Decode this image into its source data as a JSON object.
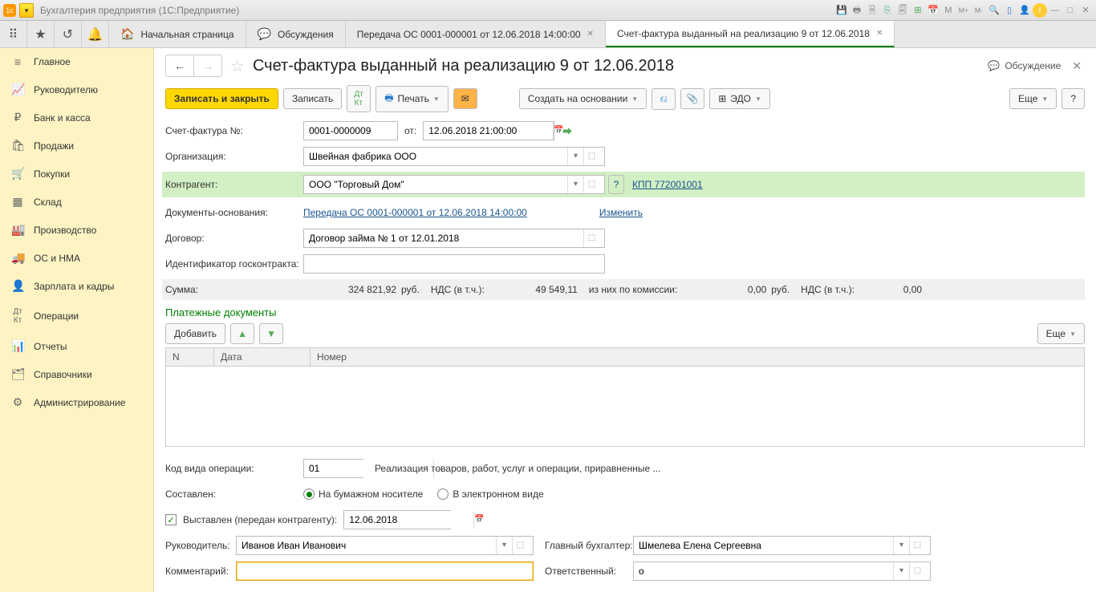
{
  "title_bar": {
    "app_title": "Бухгалтерия предприятия  (1С:Предприятие)"
  },
  "tabs": {
    "home": "Начальная страница",
    "discuss": "Обсуждения",
    "t1": "Передача ОС 0001-000001 от 12.06.2018 14:00:00",
    "t2": "Счет-фактура выданный на реализацию 9 от 12.06.2018"
  },
  "sidebar": {
    "items": [
      {
        "label": "Главное"
      },
      {
        "label": "Руководителю"
      },
      {
        "label": "Банк и касса"
      },
      {
        "label": "Продажи"
      },
      {
        "label": "Покупки"
      },
      {
        "label": "Склад"
      },
      {
        "label": "Производство"
      },
      {
        "label": "ОС и НМА"
      },
      {
        "label": "Зарплата и кадры"
      },
      {
        "label": "Операции"
      },
      {
        "label": "Отчеты"
      },
      {
        "label": "Справочники"
      },
      {
        "label": "Администрирование"
      }
    ]
  },
  "page": {
    "title": "Счет-фактура выданный на реализацию 9 от 12.06.2018",
    "discuss_label": "Обсуждение"
  },
  "toolbar": {
    "save_close": "Записать и закрыть",
    "save": "Записать",
    "print": "Печать",
    "create_based": "Создать на основании",
    "edo": "ЭДО",
    "more": "Еще",
    "help": "?"
  },
  "form": {
    "invoice_no_label": "Счет-фактура №:",
    "invoice_no": "0001-0000009",
    "from_label": "от:",
    "date": "12.06.2018 21:00:00",
    "org_label": "Организация:",
    "org": "Швейная фабрика ООО",
    "counterparty_label": "Контрагент:",
    "counterparty": "ООО \"Торговый Дом\"",
    "kpp_link": "КПП 772001001",
    "basis_label": "Документы-основания:",
    "basis_link": "Передача ОС 0001-000001 от 12.06.2018 14:00:00",
    "change_link": "Изменить",
    "contract_label": "Договор:",
    "contract": "Договор займа № 1 от 12.01.2018",
    "gov_id_label": "Идентификатор госконтракта:",
    "gov_id": ""
  },
  "summary": {
    "sum_label": "Сумма:",
    "sum_val": "324 821,92",
    "cur1": "руб.",
    "vat_label": "НДС (в т.ч.):",
    "vat_val": "49 549,11",
    "commission_label": "из них по комиссии:",
    "commission_val": "0,00",
    "cur2": "руб.",
    "vat2_label": "НДС (в т.ч.):",
    "vat2_val": "0,00"
  },
  "payments": {
    "title": "Платежные документы",
    "add": "Добавить",
    "more": "Еще",
    "col_n": "N",
    "col_date": "Дата",
    "col_no": "Номер"
  },
  "bottom": {
    "op_code_label": "Код вида операции:",
    "op_code": "01",
    "op_desc": "Реализация товаров, работ, услуг и операции, приравненные ...",
    "composed_label": "Составлен:",
    "paper": "На бумажном носителе",
    "electronic": "В электронном виде",
    "issued_label": "Выставлен (передан контрагенту):",
    "issued_date": "12.06.2018",
    "manager_label": "Руководитель:",
    "manager": "Иванов Иван Иванович",
    "accountant_label": "Главный бухгалтер:",
    "accountant": "Шмелева Елена Сергеевна",
    "comment_label": "Комментарий:",
    "comment": "",
    "responsible_label": "Ответственный:",
    "responsible": "o"
  }
}
